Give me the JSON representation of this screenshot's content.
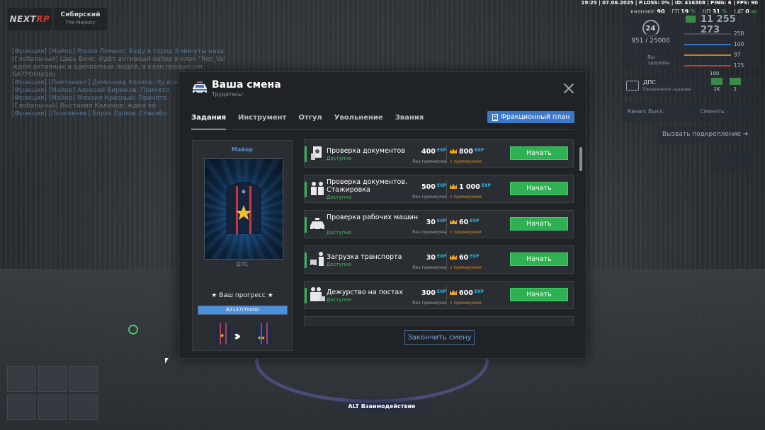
{
  "hud": {
    "logo": {
      "left": "NEXT",
      "right": "RP"
    },
    "server": {
      "name": "Сибирский",
      "sub": "The Majesty"
    },
    "status_line": "19:25 | 07.06.2025 | P.LOSS: 0% | ID: 416308 | PING: 6 | FPS: 90",
    "perf": [
      {
        "label": "кадров/с",
        "value": "90",
        "unit": ""
      },
      {
        "label": "ГП",
        "value": "19",
        "unit": "%"
      },
      {
        "label": "ЦП",
        "value": "31",
        "unit": "%"
      },
      {
        "label": "LAT",
        "value": "0",
        "unit": "мс"
      }
    ],
    "level": "24",
    "money": "11 255 273",
    "xp_value": "951",
    "xp_total": "25000",
    "heart_label": "Вы",
    "heart_sub": "здоровы",
    "stat_bars": [
      {
        "value": "250",
        "color": "#4a4f54"
      },
      {
        "value": "100",
        "color": "#3c78c8"
      },
      {
        "value": "97",
        "color": "#d07a2a"
      },
      {
        "value": "175",
        "color": "#c43a3a"
      }
    ],
    "stat_bar_extra": "188",
    "dps": {
      "title": "ДПС",
      "sub": "Ежедневное задание",
      "reward_1": "1K",
      "reward_2": "1"
    },
    "channel": {
      "label": "Канал:",
      "value": "Выкл.",
      "action": "Сменить"
    },
    "backup": "Вызвать подкрепление",
    "alt_hint": "ALT Взаимодействие"
  },
  "chat": [
    {
      "text": "[Фракция] [Майор] Ромео Леменс: Буду в город 3 минуты назад",
      "g": false
    },
    {
      "text": "[Глобальный] Царь Винс: Идёт активный набор в клан \"Rez_VatMIS\"",
      "g": true
    },
    {
      "text": "ждём активных и адекватных людей, в клан продукции",
      "g": true
    },
    {
      "text": "БАТРОНЫШЬ",
      "g": true
    },
    {
      "text": "[Фракция] [Лейтенант] Демоноид Козлов: Ну всё готово",
      "g": false
    },
    {
      "text": "[Фракция] [Майор] Алексей Бирюков: Принято",
      "g": false
    },
    {
      "text": "[Фракция] [Майор] Михаил Красный: Принято",
      "g": false
    },
    {
      "text": "[Глобальный] Выставил Калинов: ждём её",
      "g": true
    },
    {
      "text": "[Фракция] [Полковник] Борис Орлов: Спасибо",
      "g": false
    }
  ],
  "modal": {
    "title": "Ваша смена",
    "subtitle": "Трудитесь!",
    "tabs": [
      {
        "label": "Задания",
        "active": true
      },
      {
        "label": "Инструмент",
        "active": false
      },
      {
        "label": "Отгул",
        "active": false
      },
      {
        "label": "Увольнение",
        "active": false
      },
      {
        "label": "Звания",
        "active": false
      }
    ],
    "plan_button": "Фракционный план",
    "rank": {
      "name": "Майор",
      "department": "ДПС",
      "progress_label": "★ Ваш прогресс ★",
      "progress_text": "82137/70000",
      "progress_fraction": 1.0
    },
    "exp_tag": "EXP",
    "no_premium_label": "без премиума",
    "premium_label": "с премиумом",
    "tasks": [
      {
        "title": "Проверка документов",
        "status": "Доступно",
        "exp": "400",
        "exp_premium": "800",
        "button": "Начать",
        "icon": "document-check-icon",
        "two_lines": false
      },
      {
        "title": "Проверка документов. Стажировка",
        "status": "Доступно",
        "exp": "500",
        "exp_premium": "1 000",
        "button": "Начать",
        "icon": "officers-icon",
        "two_lines": true
      },
      {
        "title": "Проверка рабочих машин",
        "status": "Доступно",
        "exp": "30",
        "exp_premium": "60",
        "button": "Начать",
        "icon": "police-car-icon",
        "two_lines": true
      },
      {
        "title": "Загрузка транспорта",
        "status": "Доступно",
        "exp": "30",
        "exp_premium": "60",
        "button": "Начать",
        "icon": "tow-truck-icon",
        "two_lines": false
      },
      {
        "title": "Дежурство на постах",
        "status": "Доступно",
        "exp": "300",
        "exp_premium": "600",
        "button": "Начать",
        "icon": "post-duty-icon",
        "two_lines": false
      }
    ],
    "finish_button": "Закончить смену"
  }
}
